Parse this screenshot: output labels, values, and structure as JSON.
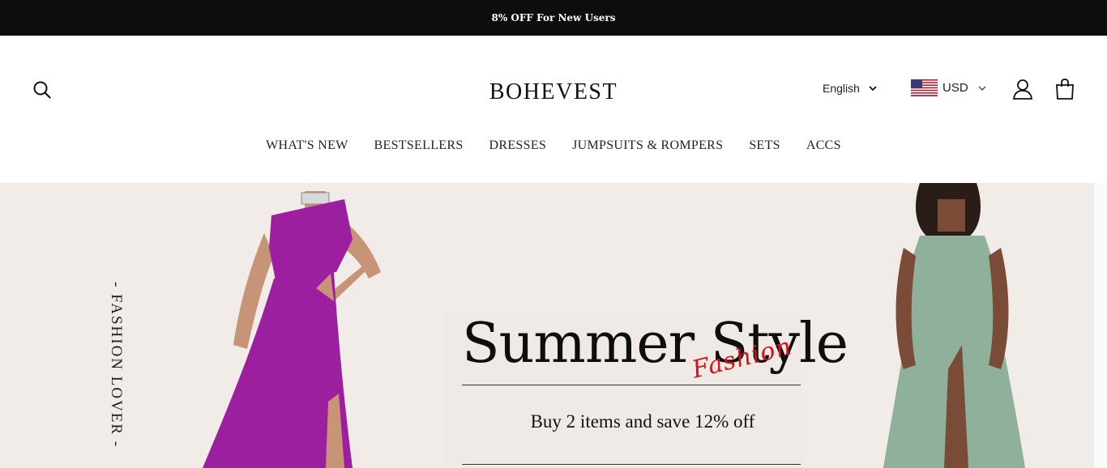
{
  "announcement": {
    "text": "8% OFF For New Users"
  },
  "header": {
    "logo": "BOHEVEST",
    "language": "English",
    "currency": "USD"
  },
  "nav": {
    "items": [
      {
        "label": "WHAT'S NEW"
      },
      {
        "label": "BESTSELLERS"
      },
      {
        "label": "DRESSES"
      },
      {
        "label": "JUMPSUITS & ROMPERS"
      },
      {
        "label": "SETS"
      },
      {
        "label": "ACCS"
      }
    ]
  },
  "hero": {
    "side_text": "- FASHION LOVER -",
    "headline": "Summer Style",
    "script_text": "Fashion",
    "promo": "Buy 2 items and save 12% off"
  },
  "colors": {
    "announcement_bg": "#0d0d0d",
    "hero_bg": "#f1ece8",
    "left_dress": "#9b1f9f",
    "right_dress": "#8fb09a",
    "accent_script": "#d3121a"
  }
}
